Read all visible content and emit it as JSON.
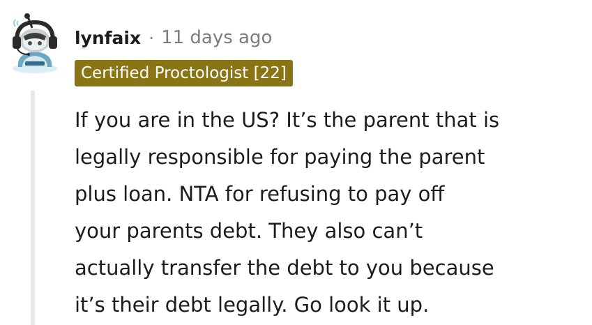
{
  "comment": {
    "author": "lynfaix",
    "separator": "·",
    "timestamp": "11 days ago",
    "flair": "Certified Proctologist [22]",
    "flair_color": "#8a7514",
    "body_lines": [
      "If you are in the US? It’s the parent that is",
      "legally responsible for paying the parent",
      "plus loan. NTA for refusing to pay off",
      "your parents debt. They also can’t",
      "actually transfer the debt to you because",
      "it’s their debt legally. Go look it up."
    ]
  },
  "icons": {
    "avatar": "snoo-avatar-with-headphones"
  }
}
